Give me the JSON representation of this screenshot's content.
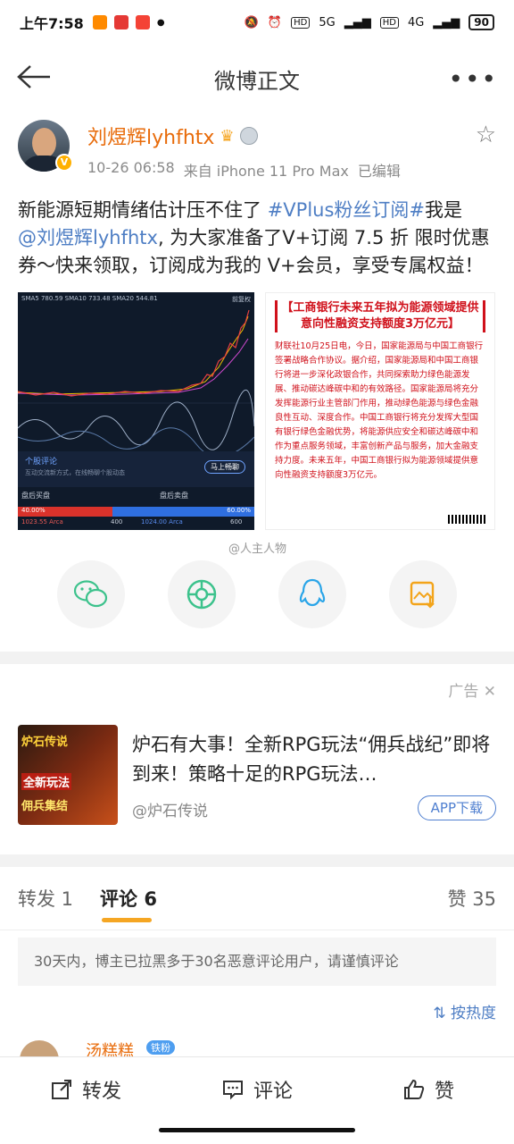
{
  "status": {
    "time": "上午7:58",
    "battery": "90",
    "sig1": "5G",
    "sig2": "4G",
    "hd": "HD"
  },
  "nav": {
    "title": "微博正文"
  },
  "post": {
    "author": "刘煜辉lyhfhtx",
    "timestamp": "10-26 06:58",
    "source": "来自 iPhone 11 Pro Max",
    "edited": "已编辑",
    "text_part1": "新能源短期情绪估计压不住了 ",
    "topic": "#VPlus粉丝订阅#",
    "text_part2": "我是",
    "mention": "@刘煜辉lyhfhtx",
    "text_part3": ", 为大家准备了V+订阅 7.5 折 限时优惠券～快来领取，订阅成为我的 V+会员，享受专属权益！"
  },
  "chart_image": {
    "ma_line": "SMA5 780.59  SMA10 733.48  SMA20 544.81",
    "adj": "前复权",
    "comment_title": "个股评论",
    "comment_sub": "互动交流新方式，在线畅聊个股动态",
    "comment_btn": "马上畅聊",
    "bid_label": "盘后买盘",
    "ask_label": "盘后卖盘",
    "bid_pct": "40.00%",
    "ask_pct": "60.00%",
    "bid_price": "1023.55 Arca",
    "bid_qty": "400",
    "ask_price": "1024.00 Arca",
    "ask_qty": "600"
  },
  "news_image": {
    "title": "【工商银行未来五年拟为能源领域提供意向性融资支持额度3万亿元】",
    "body": "财联社10月25日电，今日，国家能源局与中国工商银行签署战略合作协议。据介绍，国家能源局和中国工商银行将进一步深化政银合作，共同探索助力绿色能源发展、推动碳达峰碳中和的有效路径。国家能源局将充分发挥能源行业主管部门作用，推动绿色能源与绿色金融良性互动、深度合作。中国工商银行将充分发挥大型国有银行绿色金融优势，将能源供应安全和碳达峰碳中和作为重点服务领域，丰富创新产品与服务，加大金融支持力度。未来五年，中国工商银行拟为能源领域提供意向性融资支持额度3万亿元。"
  },
  "share": {
    "watermark": "@人主人物"
  },
  "ad": {
    "label": "广告",
    "title": "炉石有大事！全新RPG玩法“佣兵战纪”即将到来！策略十足的RPG玩法…",
    "source": "@炉石传说",
    "button": "APP下载",
    "thumb_text1": "炉石传说",
    "thumb_text2": "全新玩法",
    "thumb_text3": "佣兵集结"
  },
  "tabs": {
    "repost": "转发 1",
    "comments": "评论 6",
    "likes": "赞 35"
  },
  "notice": "30天内，博主已拉黑多于30名恶意评论用户，请谨慎评论",
  "sort": "按热度",
  "comment_preview": {
    "name": "汤糕糕",
    "badge": "铁粉"
  },
  "bottom": {
    "repost": "转发",
    "comment": "评论",
    "like": "赞"
  }
}
